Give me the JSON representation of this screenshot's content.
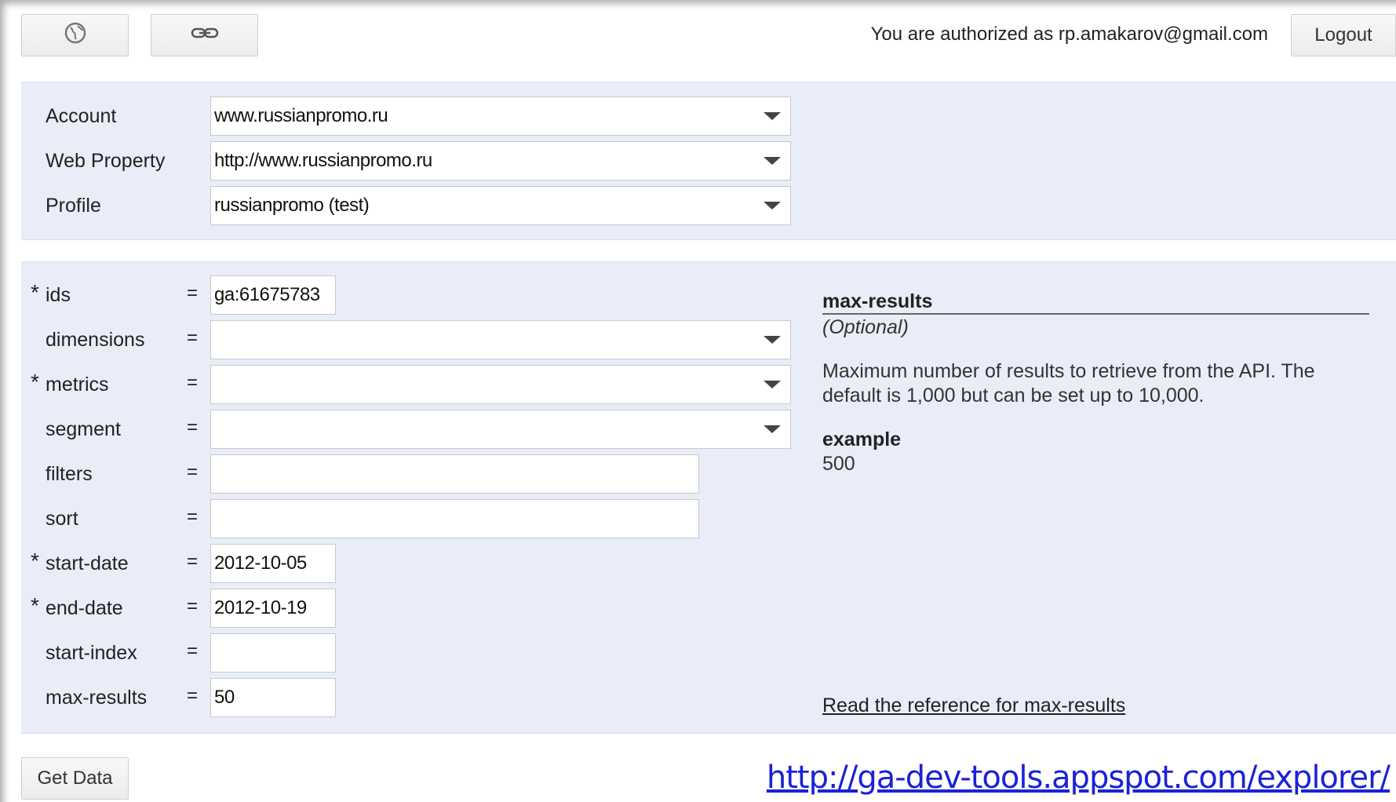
{
  "toolbar": {
    "auth_text": "You are authorized as rp.amakarov@gmail.com",
    "logout_label": "Logout",
    "globe_icon": "globe-icon",
    "link_icon": "link-icon"
  },
  "account_panel": {
    "account": {
      "label": "Account",
      "value": "www.russianpromo.ru"
    },
    "web_property": {
      "label": "Web Property",
      "value": "http://www.russianpromo.ru"
    },
    "profile": {
      "label": "Profile",
      "value": "russianpromo (test)"
    }
  },
  "query": {
    "ids": {
      "label": "ids",
      "value": "ga:61675783",
      "required": "*"
    },
    "dimensions": {
      "label": "dimensions",
      "value": ""
    },
    "metrics": {
      "label": "metrics",
      "value": "",
      "required": "*"
    },
    "segment": {
      "label": "segment",
      "value": ""
    },
    "filters": {
      "label": "filters",
      "value": ""
    },
    "sort": {
      "label": "sort",
      "value": ""
    },
    "start_date": {
      "label": "start-date",
      "value": "2012-10-05",
      "required": "*"
    },
    "end_date": {
      "label": "end-date",
      "value": "2012-10-19",
      "required": "*"
    },
    "start_index": {
      "label": "start-index",
      "value": ""
    },
    "max_results": {
      "label": "max-results",
      "value": "50"
    },
    "equals": "="
  },
  "help": {
    "title": "max-results",
    "optional": "(Optional)",
    "description": "Maximum number of results to retrieve from the API. The default is 1,000 but can be set up to 10,000.",
    "example_label": "example",
    "example_value": "500",
    "reference_link": "Read the reference for max-results"
  },
  "actions": {
    "get_data_label": "Get Data"
  },
  "footer_url": "http://ga-dev-tools.appspot.com/explorer/"
}
